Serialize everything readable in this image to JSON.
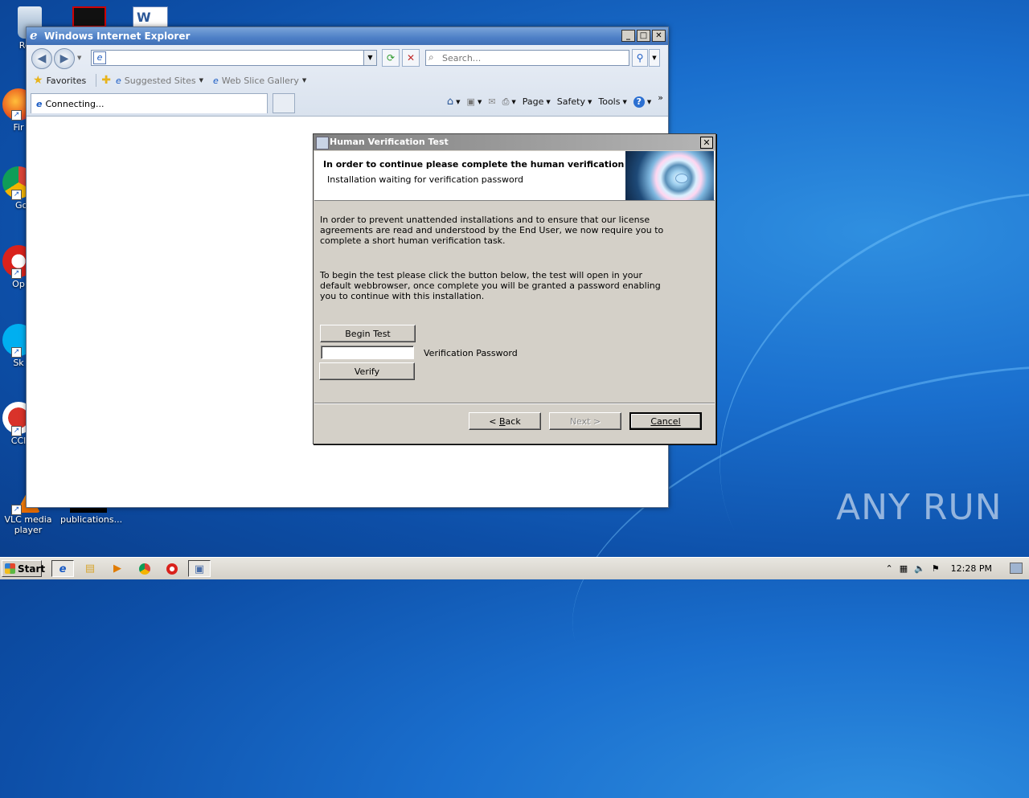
{
  "desktop": {
    "icons": [
      {
        "label": "Recy",
        "name": "recycle-bin-icon"
      },
      {
        "label": "Fir",
        "name": "firefox-icon"
      },
      {
        "label": "Go Chr",
        "name": "chrome-icon"
      },
      {
        "label": "Op",
        "name": "opera-icon"
      },
      {
        "label": "Sk",
        "name": "skype-icon"
      },
      {
        "label": "CCl",
        "name": "ccleaner-icon"
      },
      {
        "label": "VLC media player",
        "name": "vlc-icon"
      },
      {
        "label": "publications...",
        "name": "publications-file-icon"
      }
    ],
    "watermark": "ANY RUN"
  },
  "ie": {
    "title": "Windows Internet Explorer",
    "address_value": "",
    "search_placeholder": "Search...",
    "favorites_label": "Favorites",
    "suggested_sites": "Suggested Sites",
    "web_slice_gallery": "Web Slice Gallery",
    "tab_label": "Connecting...",
    "cmd": {
      "page": "Page",
      "safety": "Safety",
      "tools": "Tools"
    }
  },
  "dialog": {
    "title": "Human Verification Test",
    "heading": "In order to continue please complete the human verification test",
    "subheading": "Installation waiting for verification password",
    "paragraph1": "In order to prevent unattended installations and to ensure that our license agreements are read and understood by the End User, we now require you to complete a short human verification task.",
    "paragraph2": "To begin the test please click the button below, the test will open in your default webbrowser, once complete you will be granted a password enabling you to continue with this installation.",
    "begin_test": "Begin Test",
    "password_label": "Verification Password",
    "password_value": "",
    "verify": "Verify",
    "back_prefix": "< ",
    "back_underlined": "B",
    "back_rest": "ack",
    "next": "Next >",
    "cancel": "Cancel"
  },
  "taskbar": {
    "start": "Start",
    "clock": "12:28 PM"
  }
}
